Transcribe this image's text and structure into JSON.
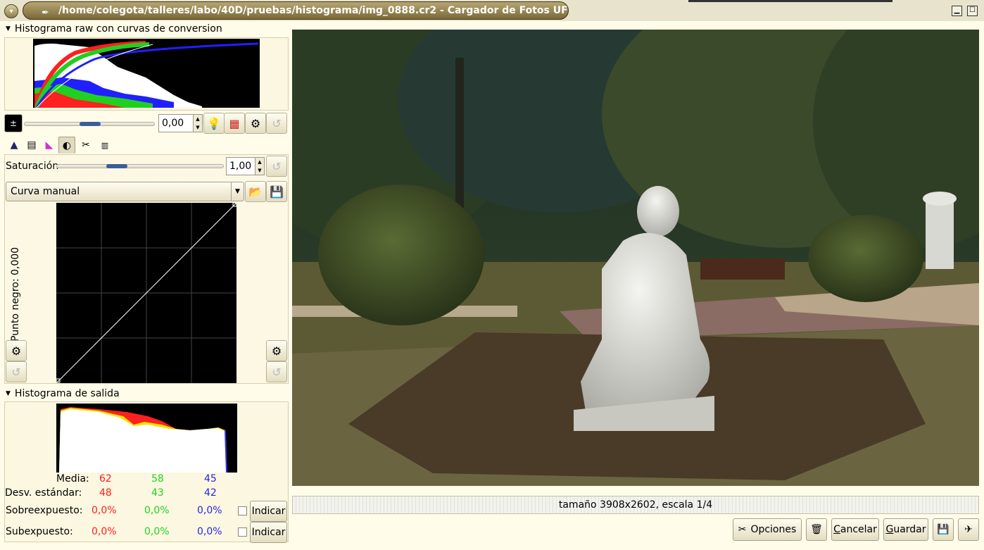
{
  "window": {
    "title": "/home/colegota/talleres/labo/40D/pruebas/histograma/img_0888.cr2 - Cargador de Fotos UFRaw"
  },
  "raw_histogram": {
    "title": "Histograma raw con curvas de conversion"
  },
  "exposure": {
    "value": "0,00"
  },
  "saturation": {
    "label": "Saturación",
    "value": "1,00",
    "level": 0.35
  },
  "curve": {
    "selected": "Curva manual",
    "black_point_label": "Punto negro: 0,000"
  },
  "output_histogram": {
    "title": "Histograma de salida"
  },
  "stats": {
    "mean_label": "Media:",
    "mean": [
      "62",
      "58",
      "45"
    ],
    "std_label": "Desv. estándar:",
    "std": [
      "48",
      "43",
      "42"
    ],
    "over_label": "Sobreexpuesto:",
    "over": [
      "0,0%",
      "0,0%",
      "0,0%"
    ],
    "under_label": "Subexpuesto:",
    "under": [
      "0,0%",
      "0,0%",
      "0,0%"
    ],
    "indicate": "Indicar"
  },
  "status": {
    "text": "tamaño 3908x2602, escala 1/4"
  },
  "buttons": {
    "options": "Opciones",
    "cancel_first": "C",
    "cancel_rest": "ancelar",
    "save_first": "G",
    "save_rest": "uardar"
  },
  "colors": {
    "red": "#ff1e1e",
    "green": "#1fd41f",
    "blue": "#2626e6",
    "titlebar": "#8c7b44"
  }
}
